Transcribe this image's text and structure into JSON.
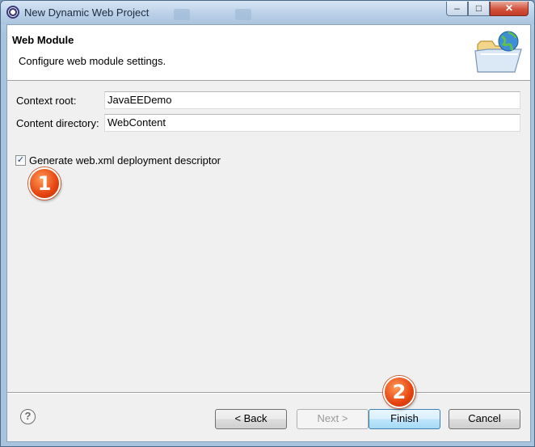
{
  "window": {
    "title": "New Dynamic Web Project",
    "controls": {
      "minimize": "–",
      "maximize": "□",
      "close": "✕"
    }
  },
  "header": {
    "title": "Web Module",
    "description": "Configure web module settings.",
    "banner_icon": "folder-globe-icon"
  },
  "form": {
    "context_root": {
      "label": "Context root:",
      "value": "JavaEEDemo"
    },
    "content_directory": {
      "label": "Content directory:",
      "value": "WebContent"
    },
    "generate_web_xml": {
      "label": "Generate web.xml deployment descriptor",
      "checked": true,
      "mark": "✓"
    }
  },
  "annotations": {
    "step1": "1",
    "step2": "2"
  },
  "footer": {
    "help": "?",
    "back": "< Back",
    "next": "Next >",
    "finish": "Finish",
    "cancel": "Cancel"
  },
  "colors": {
    "badge": "#e64410",
    "finish_border": "#3c7fb1"
  }
}
